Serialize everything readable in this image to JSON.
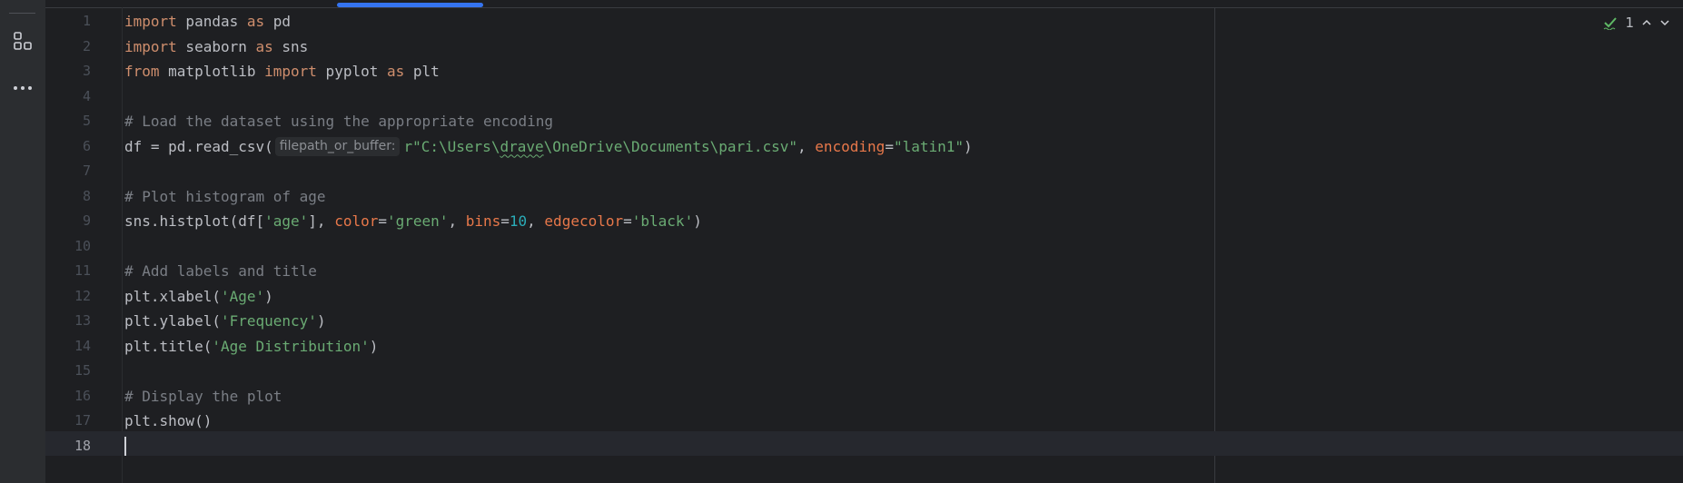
{
  "toolstrip": {
    "buttons": [
      {
        "name": "structure-icon"
      },
      {
        "name": "more-options-icon"
      }
    ]
  },
  "inspection": {
    "count": "1",
    "icon": "weak-warning-check-icon",
    "up_icon": "chevron-up-icon",
    "down_icon": "chevron-down-icon"
  },
  "editor": {
    "language": "python",
    "current_line": "18",
    "lines": [
      {
        "number": "1",
        "tokens": [
          {
            "t": "import",
            "c": "kw"
          },
          {
            "t": " pandas ",
            "c": "plain"
          },
          {
            "t": "as",
            "c": "kw"
          },
          {
            "t": " pd",
            "c": "plain"
          }
        ]
      },
      {
        "number": "2",
        "tokens": [
          {
            "t": "import",
            "c": "kw"
          },
          {
            "t": " seaborn ",
            "c": "plain"
          },
          {
            "t": "as",
            "c": "kw"
          },
          {
            "t": " sns",
            "c": "plain"
          }
        ]
      },
      {
        "number": "3",
        "tokens": [
          {
            "t": "from",
            "c": "kw"
          },
          {
            "t": " matplotlib ",
            "c": "plain"
          },
          {
            "t": "import",
            "c": "kw"
          },
          {
            "t": " pyplot ",
            "c": "plain"
          },
          {
            "t": "as",
            "c": "kw"
          },
          {
            "t": " plt",
            "c": "plain"
          }
        ]
      },
      {
        "number": "4",
        "tokens": []
      },
      {
        "number": "5",
        "tokens": [
          {
            "t": "# Load the dataset using the appropriate encoding",
            "c": "cm"
          }
        ]
      },
      {
        "number": "6",
        "tokens": [
          {
            "t": "df = pd.read_csv(",
            "c": "plain"
          },
          {
            "t": "filepath_or_buffer:",
            "c": "hint"
          },
          {
            "t": "r\"C:\\Users\\",
            "c": "str"
          },
          {
            "t": "drave",
            "c": "str squiggle"
          },
          {
            "t": "\\OneDrive\\Documents\\pari.csv\"",
            "c": "str"
          },
          {
            "t": ", ",
            "c": "plain"
          },
          {
            "t": "encoding",
            "c": "param"
          },
          {
            "t": "=",
            "c": "plain"
          },
          {
            "t": "\"latin1\"",
            "c": "str"
          },
          {
            "t": ")",
            "c": "plain"
          }
        ]
      },
      {
        "number": "7",
        "tokens": []
      },
      {
        "number": "8",
        "tokens": [
          {
            "t": "# Plot histogram of age",
            "c": "cm"
          }
        ]
      },
      {
        "number": "9",
        "tokens": [
          {
            "t": "sns.histplot(df[",
            "c": "plain"
          },
          {
            "t": "'age'",
            "c": "str"
          },
          {
            "t": "], ",
            "c": "plain"
          },
          {
            "t": "color",
            "c": "param"
          },
          {
            "t": "=",
            "c": "plain"
          },
          {
            "t": "'green'",
            "c": "str"
          },
          {
            "t": ", ",
            "c": "plain"
          },
          {
            "t": "bins",
            "c": "param"
          },
          {
            "t": "=",
            "c": "plain"
          },
          {
            "t": "10",
            "c": "num"
          },
          {
            "t": ", ",
            "c": "plain"
          },
          {
            "t": "edgecolor",
            "c": "param"
          },
          {
            "t": "=",
            "c": "plain"
          },
          {
            "t": "'black'",
            "c": "str"
          },
          {
            "t": ")",
            "c": "plain"
          }
        ]
      },
      {
        "number": "10",
        "tokens": []
      },
      {
        "number": "11",
        "tokens": [
          {
            "t": "# Add labels and title",
            "c": "cm"
          }
        ]
      },
      {
        "number": "12",
        "tokens": [
          {
            "t": "plt.xlabel(",
            "c": "plain"
          },
          {
            "t": "'Age'",
            "c": "str"
          },
          {
            "t": ")",
            "c": "plain"
          }
        ]
      },
      {
        "number": "13",
        "tokens": [
          {
            "t": "plt.ylabel(",
            "c": "plain"
          },
          {
            "t": "'Frequency'",
            "c": "str"
          },
          {
            "t": ")",
            "c": "plain"
          }
        ]
      },
      {
        "number": "14",
        "tokens": [
          {
            "t": "plt.title(",
            "c": "plain"
          },
          {
            "t": "'Age Distribution'",
            "c": "str"
          },
          {
            "t": ")",
            "c": "plain"
          }
        ]
      },
      {
        "number": "15",
        "tokens": []
      },
      {
        "number": "16",
        "tokens": [
          {
            "t": "# Display the plot",
            "c": "cm"
          }
        ]
      },
      {
        "number": "17",
        "tokens": [
          {
            "t": "plt.show()",
            "c": "plain"
          }
        ]
      },
      {
        "number": "18",
        "tokens": []
      }
    ]
  }
}
